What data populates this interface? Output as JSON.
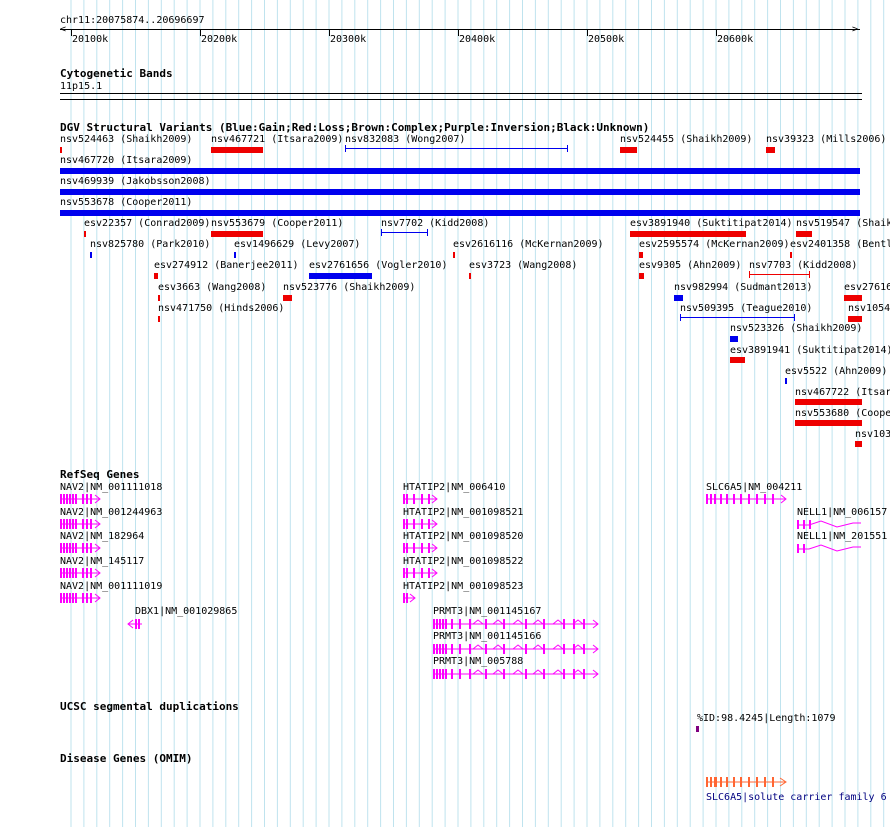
{
  "header": {
    "coords": "chr11:20075874..20696697",
    "ticks": [
      "20100k",
      "20200k",
      "20300k",
      "20400k",
      "20500k",
      "20600k"
    ]
  },
  "cyto": {
    "title": "Cytogenetic Bands",
    "band": "11p15.1"
  },
  "dgv": {
    "title": "DGV Structural Variants (Blue:Gain;Red:Loss;Brown:Complex;Purple:Inversion;Black:Unknown)",
    "colors": {
      "gain": "#0000ee",
      "loss": "#ee0000"
    },
    "items": [
      {
        "label": "nsv524463 (Shaikh2009)",
        "type": "loss"
      },
      {
        "label": "nsv467721 (Itsara2009)",
        "type": "loss"
      },
      {
        "label": "nsv832083 (Wong2007)",
        "type": "gain"
      },
      {
        "label": "nsv524455 (Shaikh2009)",
        "type": "loss"
      },
      {
        "label": "nsv39323 (Mills2006)",
        "type": "loss"
      },
      {
        "label": "nsv467720 (Itsara2009)",
        "type": "gain"
      },
      {
        "label": "nsv469939 (Jakobsson2008)",
        "type": "gain"
      },
      {
        "label": "nsv553678 (Cooper2011)",
        "type": "gain"
      },
      {
        "label": "esv22357 (Conrad2009)",
        "type": "loss"
      },
      {
        "label": "nsv553679 (Cooper2011)",
        "type": "loss"
      },
      {
        "label": "nsv7702 (Kidd2008)",
        "type": "gain"
      },
      {
        "label": "esv3891940 (Suktitipat2014)",
        "type": "loss"
      },
      {
        "label": "nsv519547 (Shaik",
        "type": "loss"
      },
      {
        "label": "nsv825780 (Park2010)",
        "type": "gain"
      },
      {
        "label": "esv1496629 (Levy2007)",
        "type": "gain"
      },
      {
        "label": "esv2616116 (McKernan2009)",
        "type": "loss"
      },
      {
        "label": "esv2595574 (McKernan2009)",
        "type": "loss"
      },
      {
        "label": "esv2401358 (Bentl",
        "type": "loss"
      },
      {
        "label": "esv274912 (Banerjee2011)",
        "type": "loss"
      },
      {
        "label": "esv2761656 (Vogler2010)",
        "type": "gain"
      },
      {
        "label": "esv3723 (Wang2008)",
        "type": "loss"
      },
      {
        "label": "esv9305 (Ahn2009)",
        "type": "loss"
      },
      {
        "label": "nsv7703 (Kidd2008)",
        "type": "loss"
      },
      {
        "label": "esv3663 (Wang2008)",
        "type": "loss"
      },
      {
        "label": "nsv523776 (Shaikh2009)",
        "type": "loss"
      },
      {
        "label": "nsv982994 (Sudmant2013)",
        "type": "gain"
      },
      {
        "label": "esv27616",
        "type": "loss"
      },
      {
        "label": "nsv471750 (Hinds2006)",
        "type": "loss"
      },
      {
        "label": "nsv509395 (Teague2010)",
        "type": "gain"
      },
      {
        "label": "nsv10545",
        "type": "loss"
      },
      {
        "label": "nsv523326 (Shaikh2009)",
        "type": "gain"
      },
      {
        "label": "esv3891941 (Suktitipat2014)",
        "type": "loss"
      },
      {
        "label": "esv5522 (Ahn2009)",
        "type": "gain"
      },
      {
        "label": "nsv467722 (Itsar",
        "type": "loss"
      },
      {
        "label": "nsv553680 (Coope",
        "type": "loss"
      },
      {
        "label": "nsv103",
        "type": "loss"
      }
    ]
  },
  "refseq": {
    "title": "RefSeq Genes",
    "color": "#ff00ff",
    "genes": [
      "NAV2|NM_001111018",
      "NAV2|NM_001244963",
      "NAV2|NM_182964",
      "NAV2|NM_145117",
      "NAV2|NM_001111019",
      "DBX1|NM_001029865",
      "HTATIP2|NM_006410",
      "HTATIP2|NM_001098521",
      "HTATIP2|NM_001098520",
      "HTATIP2|NM_001098522",
      "HTATIP2|NM_001098523",
      "PRMT3|NM_001145167",
      "PRMT3|NM_001145166",
      "PRMT3|NM_005788",
      "SLC6A5|NM_004211",
      "NELL1|NM_006157",
      "NELL1|NM_201551"
    ]
  },
  "segdup": {
    "title": "UCSC segmental duplications",
    "label": "%ID:98.4245|Length:1079",
    "color": "#800080"
  },
  "omim": {
    "title": "Disease Genes (OMIM)",
    "label": "SLC6A5|solute carrier family 6",
    "color": "#ff6633",
    "label_color": "#000080"
  }
}
